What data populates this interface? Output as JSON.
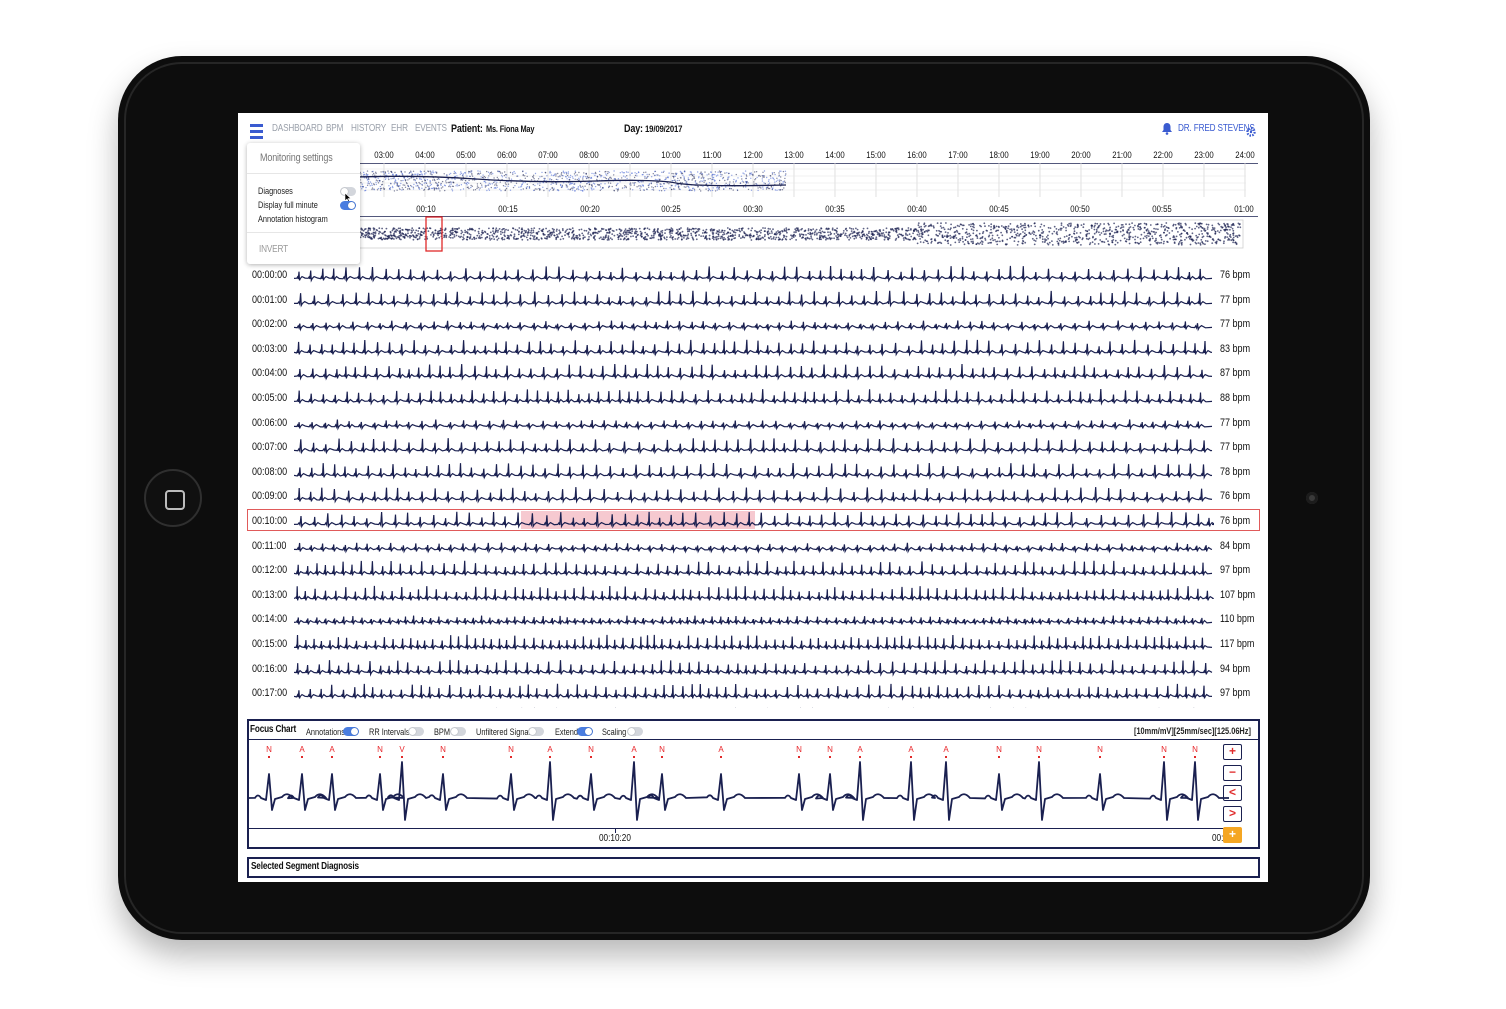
{
  "nav": {
    "items": [
      "DASHBOARD",
      "BPM",
      "HISTORY",
      "EHR",
      "EVENTS"
    ],
    "patient_label": "Patient:",
    "patient_name": "Ms. Fiona May",
    "day_label": "Day:",
    "day_value": "19/09/2017",
    "doctor": "DR. FRED STEVENS"
  },
  "settings_menu": {
    "title": "Monitoring settings",
    "options": [
      {
        "label": "Diagnoses",
        "on": false
      },
      {
        "label": "Display full minute",
        "on": true
      },
      {
        "label": "Annotation histogram",
        "on": false
      }
    ],
    "invert_label": "INVERT"
  },
  "day_timeline": {
    "ticks": [
      "03:00",
      "04:00",
      "05:00",
      "06:00",
      "07:00",
      "08:00",
      "09:00",
      "10:00",
      "11:00",
      "12:00",
      "13:00",
      "14:00",
      "15:00",
      "16:00",
      "17:00",
      "18:00",
      "19:00",
      "20:00",
      "21:00",
      "22:00",
      "23:00",
      "24:00"
    ]
  },
  "hour_timeline": {
    "ticks": [
      "00:10",
      "00:15",
      "00:20",
      "00:25",
      "00:30",
      "00:35",
      "00:40",
      "00:45",
      "00:50",
      "00:55",
      "01:00"
    ]
  },
  "ecg_rows": [
    {
      "time": "00:00:00",
      "bpm": "76 bpm"
    },
    {
      "time": "00:01:00",
      "bpm": "77 bpm"
    },
    {
      "time": "00:02:00",
      "bpm": "77 bpm"
    },
    {
      "time": "00:03:00",
      "bpm": "83 bpm"
    },
    {
      "time": "00:04:00",
      "bpm": "87 bpm"
    },
    {
      "time": "00:05:00",
      "bpm": "88 bpm"
    },
    {
      "time": "00:06:00",
      "bpm": "77 bpm"
    },
    {
      "time": "00:07:00",
      "bpm": "77 bpm"
    },
    {
      "time": "00:08:00",
      "bpm": "78 bpm"
    },
    {
      "time": "00:09:00",
      "bpm": "76 bpm"
    },
    {
      "time": "00:10:00",
      "bpm": "76 bpm",
      "selected": true
    },
    {
      "time": "00:11:00",
      "bpm": "84 bpm"
    },
    {
      "time": "00:12:00",
      "bpm": "97 bpm"
    },
    {
      "time": "00:13:00",
      "bpm": "107 bpm"
    },
    {
      "time": "00:14:00",
      "bpm": "110 bpm"
    },
    {
      "time": "00:15:00",
      "bpm": "117 bpm"
    },
    {
      "time": "00:16:00",
      "bpm": "94 bpm"
    },
    {
      "time": "00:17:00",
      "bpm": "97 bpm"
    }
  ],
  "focus_chart": {
    "title": "Focus Chart",
    "toggles": [
      {
        "label": "Annotations",
        "on": true
      },
      {
        "label": "RR Intervals",
        "on": false
      },
      {
        "label": "BPM",
        "on": false
      },
      {
        "label": "Unfiltered Signal",
        "on": false
      },
      {
        "label": "Extend",
        "on": true
      },
      {
        "label": "Scaling",
        "on": false
      }
    ],
    "scale_info": "[10mm/mV][25mm/sec][125.06Hz]",
    "annotations": [
      "N",
      "A",
      "A",
      "N",
      "V",
      "N",
      "N",
      "A",
      "N",
      "A",
      "N",
      "A",
      "N",
      "N",
      "A",
      "A",
      "A",
      "N",
      "N",
      "N",
      "N",
      "N"
    ],
    "time_center": "00:10:20",
    "time_right": "00:1",
    "controls": [
      "+",
      "−",
      "<",
      ">",
      "+"
    ]
  },
  "diagnosis_bar": {
    "title": "Selected Segment Diagnosis"
  },
  "colors": {
    "trace": "#1a2050",
    "accent": "#3a5bd0",
    "alert": "#e02a2a",
    "highlight": "#f6c9d0",
    "orange": "#f5a623"
  }
}
